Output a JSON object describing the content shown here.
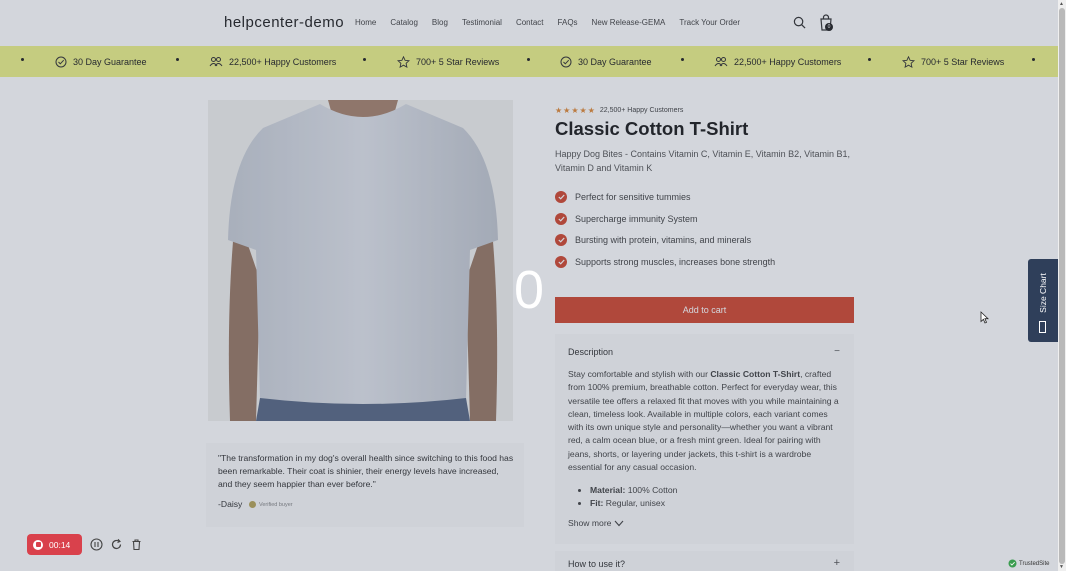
{
  "header": {
    "logo": "helpcenter-demo",
    "nav": [
      "Home",
      "Catalog",
      "Blog",
      "Testimonial",
      "Contact",
      "FAQs",
      "New Release-GEMA",
      "Track Your Order"
    ],
    "cart_count": "0"
  },
  "marquee": {
    "items": [
      "30 Day Guarantee",
      "22,500+ Happy Customers",
      "700+ 5 Star Reviews",
      "30 Day Guarantee",
      "22,500+ Happy Customers",
      "700+ 5 Star Reviews"
    ]
  },
  "product": {
    "rating_stars": 5,
    "rating_text": "22,500+ Happy Customers",
    "title": "Classic Cotton T-Shirt",
    "subtitle": "Happy Dog Bites - Contains Vitamin C, Vitamin E, Vitamin B2, Vitamin B1, Vitamin D and Vitamin K",
    "features": [
      "Perfect for sensitive tummies",
      "Supercharge immunity System",
      "Bursting with protein, vitamins, and minerals",
      "Supports strong muscles, increases bone strength"
    ],
    "add_to_cart": "Add to cart"
  },
  "description": {
    "title": "Description",
    "text_before": "Stay comfortable and stylish with our ",
    "text_bold": "Classic Cotton T-Shirt",
    "text_after": ", crafted from 100% premium, breathable cotton. Perfect for everyday wear, this versatile tee offers a relaxed fit that moves with you while maintaining a clean, timeless look. Available in multiple colors, each variant comes with its own unique style and personality—whether you want a vibrant red, a calm ocean blue, or a fresh mint green. Ideal for pairing with jeans, shorts, or layering under jackets, this t-shirt is a wardrobe essential for any casual occasion.",
    "specs": [
      {
        "label": "Material:",
        "value": " 100% Cotton"
      },
      {
        "label": "Fit:",
        "value": " Regular, unisex"
      }
    ],
    "show_more": "Show more"
  },
  "howto": {
    "title": "How to use it?"
  },
  "testimonial": {
    "quote": "\"The transformation in my dog's overall health since switching to this food has been remarkable. Their coat is shinier, their energy levels have increased, and they seem happier than ever before.\"",
    "author": "-Daisy",
    "verified": "Verified buyer"
  },
  "overlay": {
    "countdown": "0"
  },
  "size_chart": {
    "label": "Size Chart"
  },
  "recorder": {
    "time": "00:14"
  },
  "badge": {
    "trusted": "TrustedSite"
  },
  "colors": {
    "accent": "#d34a31",
    "marquee_bg": "#eef28a",
    "rec_red": "#d9414c",
    "size_chart_bg": "#2f3f5a"
  }
}
